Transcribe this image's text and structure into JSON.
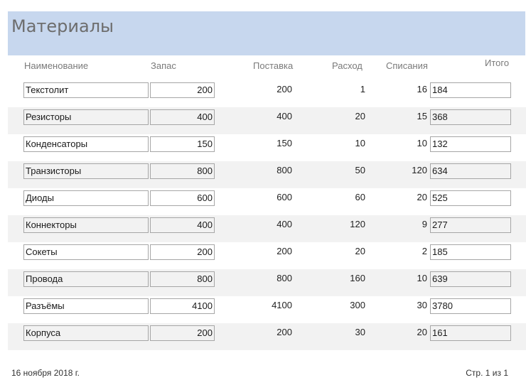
{
  "report": {
    "title": "Материалы",
    "columns": {
      "name": "Наименование",
      "stock": "Запас",
      "supply": "Поставка",
      "usage": "Расход",
      "writeoff": "Списания",
      "total": "Итого"
    },
    "rows": [
      {
        "name": "Текстолит",
        "stock": "200",
        "supply": "200",
        "usage": "1",
        "writeoff": "16",
        "total": "184"
      },
      {
        "name": "Резисторы",
        "stock": "400",
        "supply": "400",
        "usage": "20",
        "writeoff": "15",
        "total": "368"
      },
      {
        "name": "Конденсаторы",
        "stock": "150",
        "supply": "150",
        "usage": "10",
        "writeoff": "10",
        "total": "132"
      },
      {
        "name": "Транзисторы",
        "stock": "800",
        "supply": "800",
        "usage": "50",
        "writeoff": "120",
        "total": "634"
      },
      {
        "name": "Диоды",
        "stock": "600",
        "supply": "600",
        "usage": "60",
        "writeoff": "20",
        "total": "525"
      },
      {
        "name": "Коннекторы",
        "stock": "400",
        "supply": "400",
        "usage": "120",
        "writeoff": "9",
        "total": "277"
      },
      {
        "name": "Сокеты",
        "stock": "200",
        "supply": "200",
        "usage": "20",
        "writeoff": "2",
        "total": "185"
      },
      {
        "name": "Провода",
        "stock": "800",
        "supply": "800",
        "usage": "160",
        "writeoff": "10",
        "total": "639"
      },
      {
        "name": "Разъёмы",
        "stock": "4100",
        "supply": "4100",
        "usage": "300",
        "writeoff": "30",
        "total": "3780"
      },
      {
        "name": "Корпуса",
        "stock": "200",
        "supply": "200",
        "usage": "30",
        "writeoff": "20",
        "total": "161"
      }
    ],
    "footer": {
      "date": "16 ноября 2018 г.",
      "page": "Стр. 1 из 1"
    },
    "colors": {
      "header_band": "#c7d7ee",
      "row_shade": "#f2f2f2"
    }
  }
}
